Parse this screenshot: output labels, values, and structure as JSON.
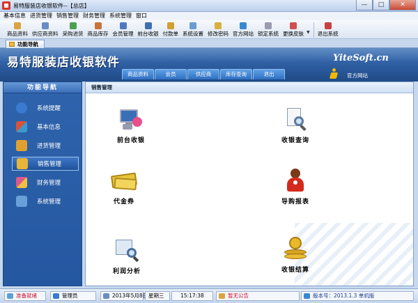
{
  "window": {
    "title": "易特服装店收银软件--【总店】",
    "controls": [
      "—",
      "□",
      "✕"
    ]
  },
  "menu": [
    "基本信息",
    "进货管理",
    "销售管理",
    "财务管理",
    "系统管理",
    "窗口"
  ],
  "toolbar": {
    "buttons": [
      {
        "label": "商品资料",
        "icon": "goods-icon",
        "color": "#d9a441"
      },
      {
        "label": "供应商资料",
        "icon": "supplier-icon",
        "color": "#6a8cc4"
      },
      {
        "label": "采购进货",
        "icon": "purchase-icon",
        "color": "#4aa050"
      },
      {
        "label": "商品库存",
        "icon": "inventory-icon",
        "color": "#c9753a"
      },
      {
        "label": "会员管理",
        "icon": "member-icon",
        "color": "#4f79c0"
      },
      {
        "label": "前台收银",
        "icon": "cashier-icon",
        "color": "#3f6fb0"
      },
      {
        "label": "付款单",
        "icon": "payment-icon",
        "color": "#d0a030"
      },
      {
        "label": "系统设置",
        "icon": "settings-icon",
        "color": "#6b9cd0"
      },
      {
        "label": "修改密码",
        "icon": "password-icon",
        "color": "#d8b040"
      },
      {
        "label": "官方网站",
        "icon": "website-icon",
        "color": "#3a86d0"
      },
      {
        "label": "锁定系统",
        "icon": "lock-icon",
        "color": "#9a9ab0"
      },
      {
        "label": "更换皮肤",
        "icon": "skin-icon",
        "color": "#d05050"
      }
    ],
    "exit_label": "退出系统"
  },
  "tab": {
    "label": "功能导航"
  },
  "banner": {
    "title": "易特服装店收银软件",
    "brand": "YiteSoft.cn",
    "nav": [
      "商品资料",
      "会员",
      "供应商",
      "库存查询",
      "退出"
    ],
    "site_link": "官方网站"
  },
  "sidebar": {
    "header": "功能导航",
    "items": [
      {
        "label": "系统提醒",
        "icon": "info-icon",
        "color": "#3a7ad0",
        "active": false
      },
      {
        "label": "基本信息",
        "icon": "cubes-icon",
        "color": "#d9523a",
        "active": false
      },
      {
        "label": "进货管理",
        "icon": "box-in-icon",
        "color": "#e0a030",
        "active": false
      },
      {
        "label": "销售管理",
        "icon": "box-out-icon",
        "color": "#e8b43a",
        "active": true
      },
      {
        "label": "财务管理",
        "icon": "finance-icon",
        "color": "#d95a8a",
        "active": false
      },
      {
        "label": "系统管理",
        "icon": "system-icon",
        "color": "#6aa0d8",
        "active": false
      }
    ]
  },
  "content": {
    "header": "销售管理",
    "functions": [
      {
        "label": "前台收银",
        "icon": "cashier-monitor-icon"
      },
      {
        "label": "收银查询",
        "icon": "document-search-icon"
      },
      {
        "label": "代金券",
        "icon": "banknotes-icon"
      },
      {
        "label": "导购报表",
        "icon": "salesperson-icon"
      },
      {
        "label": "利润分析",
        "icon": "chart-search-icon"
      },
      {
        "label": "收银结算",
        "icon": "coins-icon"
      }
    ]
  },
  "statusbar": {
    "ready": "准备就绪",
    "user": "管理员",
    "date": "2013年5月8日",
    "weekday": "星期三",
    "time": "15:17:38",
    "notice": "暂无公告",
    "version": "版本号：2013.1.3 单机版"
  }
}
